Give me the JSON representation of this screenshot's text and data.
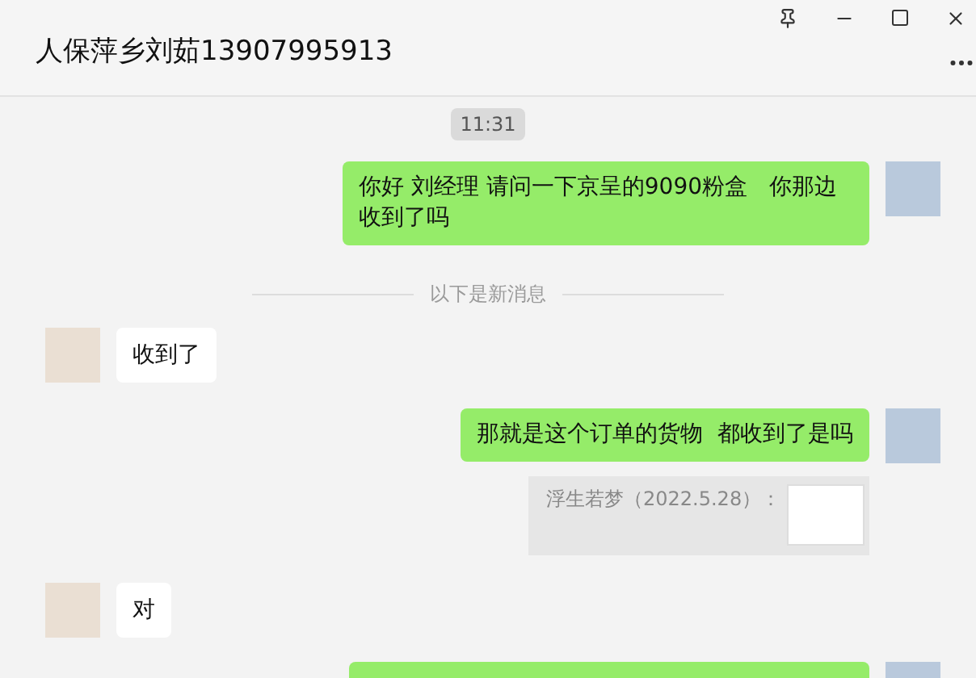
{
  "window": {
    "title": "人保萍乡刘茹13907995913"
  },
  "messages": [
    {
      "kind": "time",
      "text": "11:31"
    },
    {
      "kind": "outgoing",
      "text": "你好 刘经理 请问一下京呈的9090粉盒   你那边收到了吗"
    },
    {
      "kind": "divider",
      "text": "以下是新消息"
    },
    {
      "kind": "incoming",
      "text": "收到了"
    },
    {
      "kind": "outgoing",
      "text": "那就是这个订单的货物  都收到了是吗",
      "quote": "浮生若梦（2022.5.28）："
    },
    {
      "kind": "incoming",
      "text": "对"
    },
    {
      "kind": "outgoing_cut"
    }
  ]
}
